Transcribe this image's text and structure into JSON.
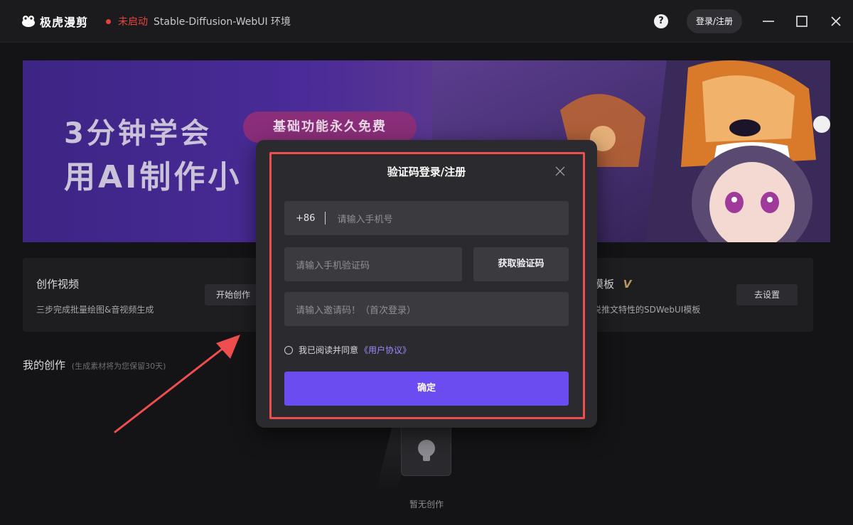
{
  "app": {
    "title": "极虎漫剪",
    "status": "未启动",
    "env_name": "Stable-Diffusion-WebUI 环境",
    "help_label": "?",
    "login_label": "登录/注册",
    "status_color": "#e5423b"
  },
  "banner": {
    "line1": "3分钟学会",
    "line2": "用AI制作小",
    "pill": "基础功能永久免费"
  },
  "cards": [
    {
      "title": "创作视频",
      "desc": "三步完成批量绘图&音视频生成",
      "button": "开始创作"
    },
    {
      "title": "模板",
      "title_badge": "V",
      "desc": "说推文特性的SDWebUI模板",
      "button": "去设置"
    }
  ],
  "my_creation": {
    "title": "我的创作",
    "note": "(生成素材将为您保留30天)",
    "empty_text": "暂无创作"
  },
  "modal": {
    "title": "验证码登录/注册",
    "country_code": "+86",
    "phone_placeholder": "请输入手机号",
    "code_placeholder": "请输入手机验证码",
    "get_code_label": "获取验证码",
    "invite_placeholder": "请输入邀请码！（首次登录）",
    "agree_text": "我已阅读并同意",
    "agree_link": "《用户协议》",
    "confirm_label": "确定",
    "accent_color": "#6b4cf0",
    "highlight_color": "#ee4e4e"
  },
  "icons": [
    "frog-logo-icon",
    "help-icon",
    "minimize-icon",
    "maximize-icon",
    "close-window-icon",
    "modal-close-icon",
    "lightbulb-icon",
    "annotation-arrow-icon"
  ]
}
